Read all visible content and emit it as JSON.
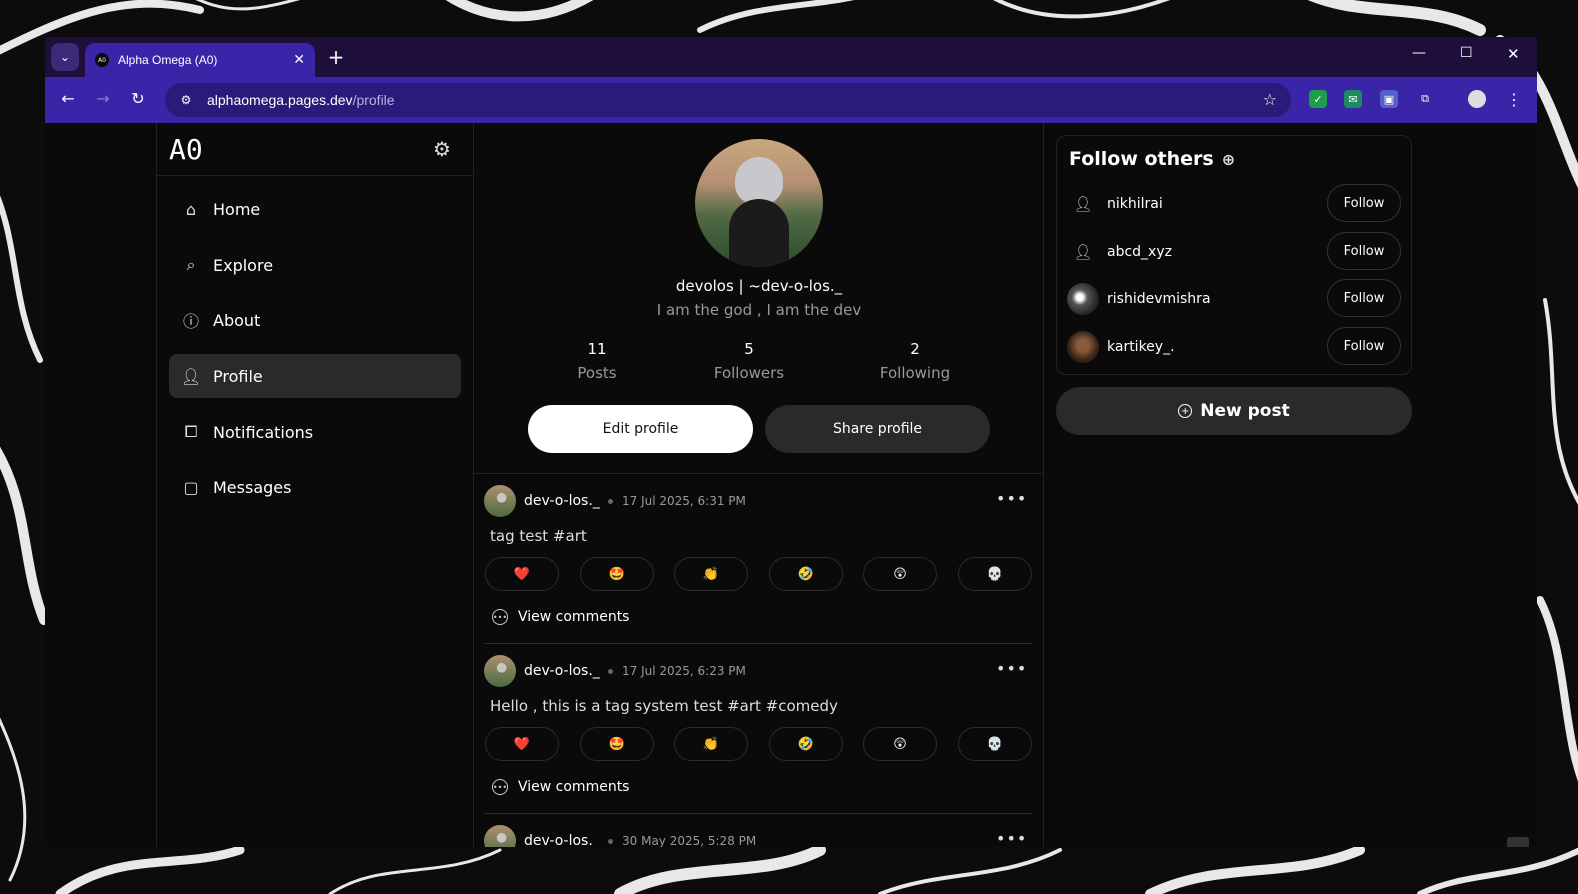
{
  "browser": {
    "tab_title": "Alpha Omega (A0)",
    "tab_favicon": "A0",
    "url_host": "alphaomega.pages.dev",
    "url_path": "/profile"
  },
  "app": {
    "logo": "A0"
  },
  "sidebar": {
    "items": [
      {
        "label": "Home",
        "icon": "home-icon",
        "active": false
      },
      {
        "label": "Explore",
        "icon": "search-icon",
        "active": false
      },
      {
        "label": "About",
        "icon": "info-icon",
        "active": false
      },
      {
        "label": "Profile",
        "icon": "user-icon",
        "active": true
      },
      {
        "label": "Notifications",
        "icon": "notification-icon",
        "active": false
      },
      {
        "label": "Messages",
        "icon": "message-icon",
        "active": false
      }
    ]
  },
  "profile": {
    "name": "devolos | ~dev-o-los._",
    "bio": "I am the god , I am the dev",
    "stats": [
      {
        "num": "11",
        "label": "Posts"
      },
      {
        "num": "5",
        "label": "Followers"
      },
      {
        "num": "2",
        "label": "Following"
      }
    ],
    "edit_label": "Edit profile",
    "share_label": "Share profile"
  },
  "reactions": [
    "❤️",
    "🤩",
    "👏",
    "🤣",
    "😲",
    "💀"
  ],
  "posts": [
    {
      "user": "dev-o-los._",
      "time": "17 Jul 2025, 6:31 PM",
      "text": "tag test #art",
      "comments_label": "View comments"
    },
    {
      "user": "dev-o-los._",
      "time": "17 Jul 2025, 6:23 PM",
      "text": "Hello , this is a tag system test #art #comedy",
      "comments_label": "View comments"
    },
    {
      "user": "dev-o-los._",
      "time": "30 May 2025, 5:28 PM",
      "text": "",
      "comments_label": ""
    }
  ],
  "follow_others": {
    "title": "Follow others",
    "suggestions": [
      {
        "name": "nikhilrai",
        "button": "Follow"
      },
      {
        "name": "abcd_xyz",
        "button": "Follow"
      },
      {
        "name": "rishidevmishra",
        "button": "Follow"
      },
      {
        "name": "kartikey_.",
        "button": "Follow"
      }
    ]
  },
  "new_post_label": "New post",
  "colors": {
    "tab_bar": "#1e0f3a",
    "toolbar": "#3a25a8",
    "page_bg": "#0a0a0a"
  }
}
